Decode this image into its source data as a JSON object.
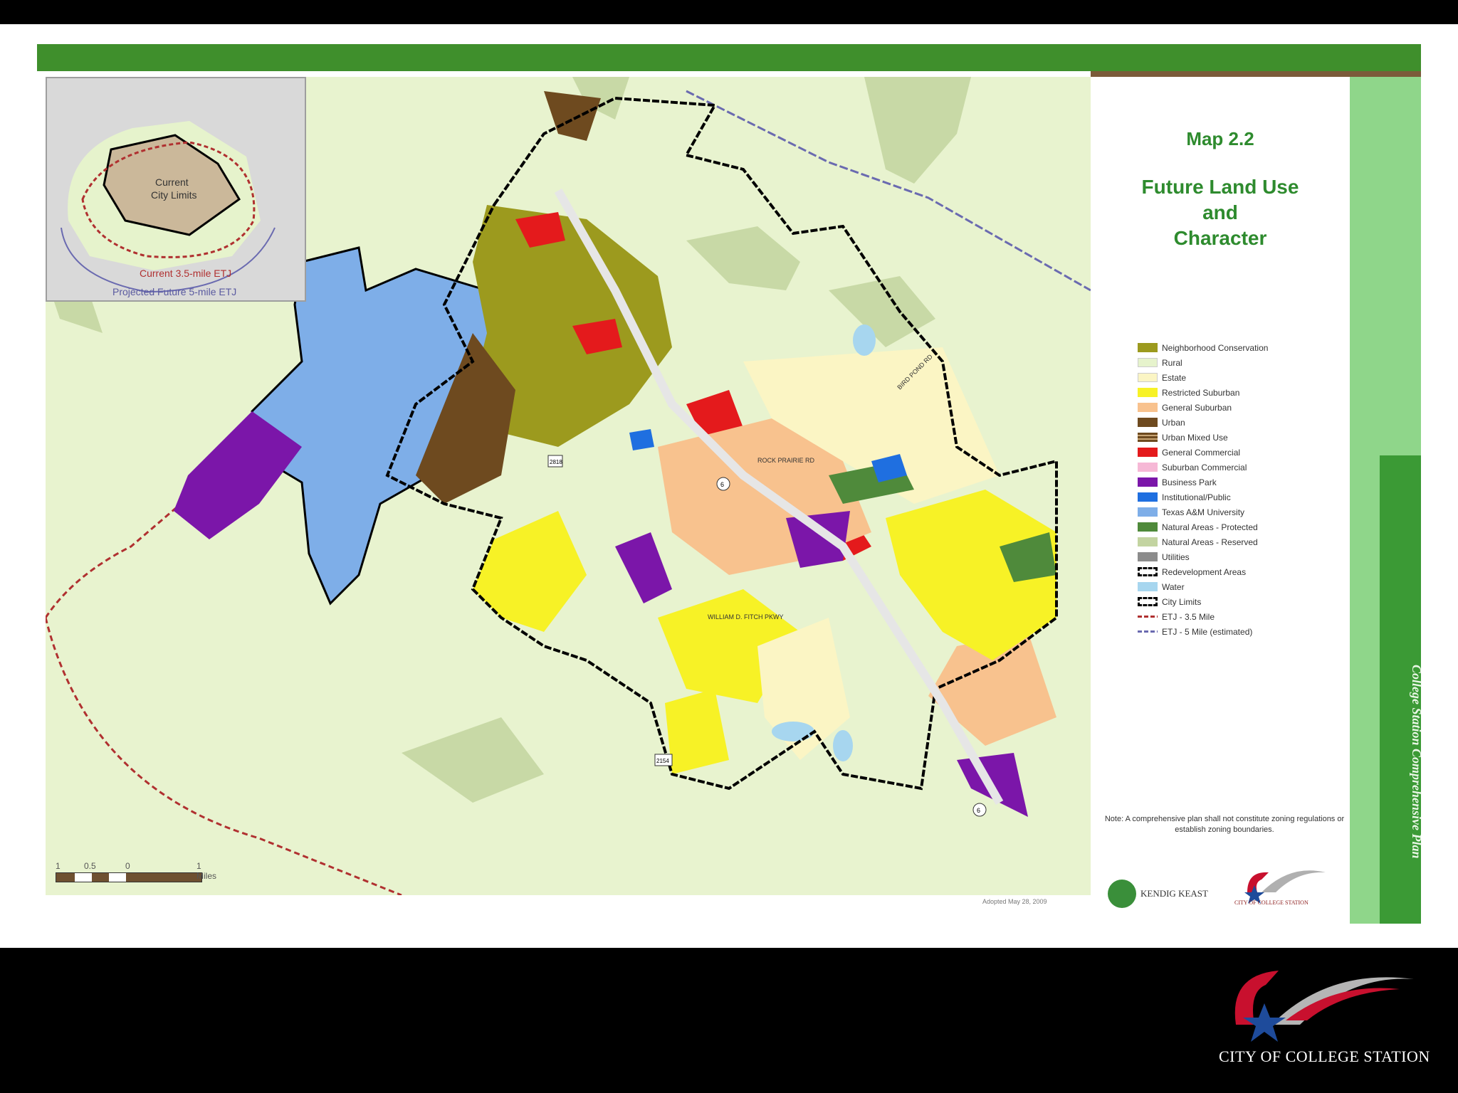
{
  "map": {
    "number": "Map 2.2",
    "title_lines": [
      "Future Land Use",
      "and",
      "Character"
    ],
    "side_title": "College Station Comprehensive Plan",
    "inset_labels": [
      "Current",
      "City Limits",
      "Current 3.5-mile ETJ",
      "Projected Future 5-mile ETJ"
    ],
    "road_labels": [
      "2818",
      "6",
      "6",
      "2154",
      "ROCK PRAIRIE RD",
      "WILLIAM D. FITCH PKWY",
      "BIRD POND RD"
    ],
    "scale_labels": [
      "1",
      "0.5",
      "0",
      "1 Miles"
    ],
    "note": "Note: A comprehensive plan shall not constitute zoning regulations or establish zoning boundaries.",
    "adopted": "Adopted May 28, 2009",
    "logos": {
      "kendig": "KENDIG KEAST",
      "city_small": "CITY OF COLLEGE STATION"
    },
    "footer": "CITY OF COLLEGE STATION"
  },
  "legend": [
    {
      "label": "Neighborhood Conservation",
      "color": "#9c9a1e"
    },
    {
      "label": "Rural",
      "color": "#e6f3cc"
    },
    {
      "label": "Estate",
      "color": "#fbf5c4"
    },
    {
      "label": "Restricted Suburban",
      "color": "#f7f226"
    },
    {
      "label": "General Suburban",
      "color": "#f8c28e"
    },
    {
      "label": "Urban",
      "color": "#6e4a1f"
    },
    {
      "label": "Urban Mixed Use",
      "color": "#6e4a1f"
    },
    {
      "label": "General Commercial",
      "color": "#e41a1c"
    },
    {
      "label": "Suburban Commercial",
      "color": "#f6b8d6"
    },
    {
      "label": "Business Park",
      "color": "#7b16a9"
    },
    {
      "label": "Institutional/Public",
      "color": "#1f6fe0"
    },
    {
      "label": "Texas A&M University",
      "color": "#7eaee8"
    },
    {
      "label": "Natural Areas - Protected",
      "color": "#4f8a3b"
    },
    {
      "label": "Natural Areas - Reserved",
      "color": "#c3d4a1"
    },
    {
      "label": "Utilities",
      "color": "#8c8c8c"
    },
    {
      "label": "Redevelopment Areas",
      "color": "#ffffff"
    },
    {
      "label": "Water",
      "color": "#a7d6ef"
    },
    {
      "label": "City Limits",
      "color": "#ffffff"
    },
    {
      "label": "ETJ - 3.5 Mile",
      "color": "#b03030"
    },
    {
      "label": "ETJ - 5 Mile (estimated)",
      "color": "#6a6ab0"
    }
  ]
}
